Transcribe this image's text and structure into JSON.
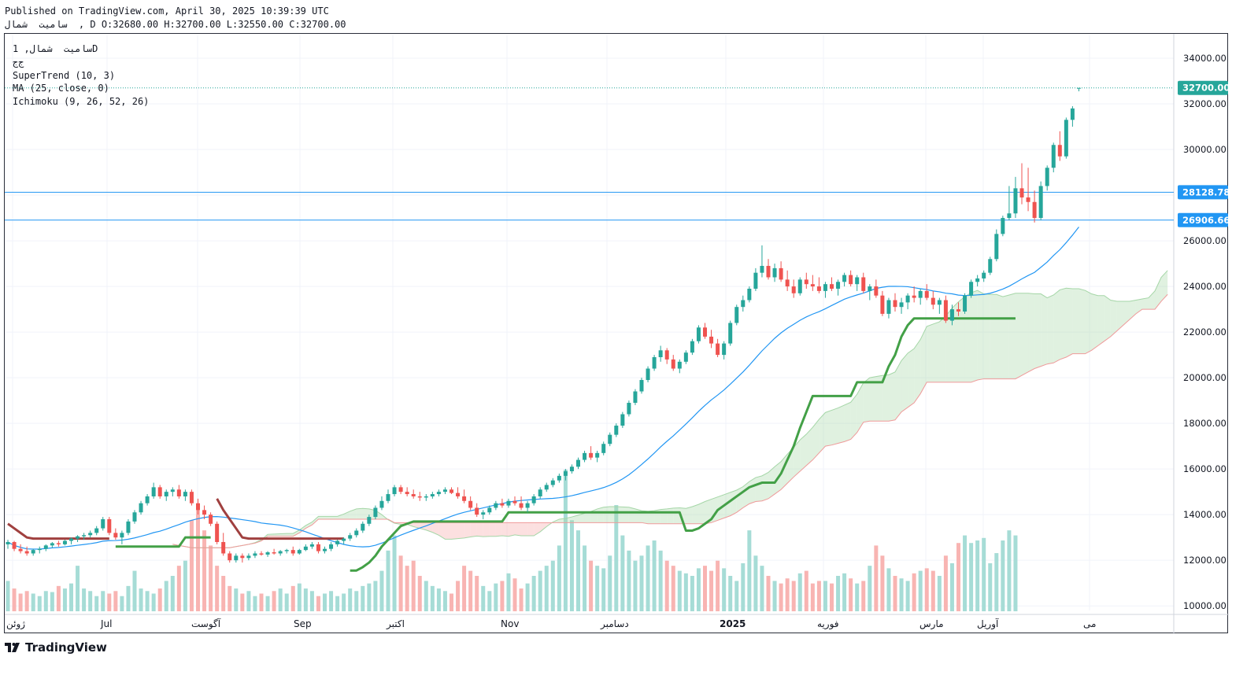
{
  "header": {
    "published": "Published on TradingView.com, April 30, 2025 10:39:39 UTC",
    "ohlc": "سامیت  شمال  , D O:32680.00 H:32700.00 L:32550.00 C:32700.00"
  },
  "legend": {
    "symbol": "سامیت  شمال, 1D",
    "exchange": "ج‌ج",
    "supertrend": "SuperTrend (10, 3)",
    "ma": "MA (25, close, 0)",
    "ichimoku": "Ichimoku (9, 26, 52, 26)"
  },
  "brand": "TradingView",
  "colors": {
    "up": "#26a69a",
    "down": "#ef5350",
    "supertrend_up": "#43a047",
    "supertrend_down": "#a0403f",
    "ma": "#2196f3",
    "cloud_green": "#a5d6a7",
    "cloud_red": "#f8bbbb",
    "hline": "#2196f3"
  },
  "chart_data": {
    "type": "candlestick",
    "ylim": [
      9800,
      35000
    ],
    "y_ticks": [
      "34000.00",
      "32000.00",
      "30000.00",
      "28000.00",
      "26000.00",
      "24000.00",
      "22000.00",
      "20000.00",
      "18000.00",
      "16000.00",
      "14000.00",
      "12000.00",
      "10000.00"
    ],
    "x_ticks": [
      "ژوئن",
      "Jul",
      "آگوست",
      "Sep",
      "اکتبر",
      "Nov",
      "دسامبر",
      "2025",
      "فوریه",
      "مارس",
      "آوریل",
      "می"
    ],
    "last_price": "32700.00",
    "horizontal_lines": [
      "28128.78",
      "26906.66"
    ],
    "candles": [
      [
        12700,
        12900,
        12500,
        12800
      ],
      [
        12800,
        12850,
        12400,
        12500
      ],
      [
        12500,
        12700,
        12300,
        12400
      ],
      [
        12400,
        12600,
        12200,
        12300
      ],
      [
        12300,
        12500,
        12200,
        12450
      ],
      [
        12450,
        12600,
        12300,
        12500
      ],
      [
        12500,
        12700,
        12400,
        12650
      ],
      [
        12650,
        12800,
        12550,
        12750
      ],
      [
        12750,
        12850,
        12600,
        12700
      ],
      [
        12700,
        12900,
        12650,
        12850
      ],
      [
        12850,
        13000,
        12700,
        12950
      ],
      [
        12950,
        13100,
        12800,
        13050
      ],
      [
        13050,
        13200,
        12900,
        13100
      ],
      [
        13100,
        13300,
        13000,
        13200
      ],
      [
        13200,
        13500,
        13100,
        13400
      ],
      [
        13400,
        13900,
        13300,
        13800
      ],
      [
        13800,
        13900,
        13100,
        13200
      ],
      [
        13200,
        13400,
        12900,
        13000
      ],
      [
        13000,
        13300,
        12700,
        13200
      ],
      [
        13200,
        13800,
        13100,
        13700
      ],
      [
        13700,
        14200,
        13600,
        14100
      ],
      [
        14100,
        14600,
        14000,
        14500
      ],
      [
        14500,
        14900,
        14400,
        14800
      ],
      [
        14800,
        15400,
        14700,
        15200
      ],
      [
        15200,
        15300,
        14700,
        14800
      ],
      [
        14800,
        15100,
        14600,
        15000
      ],
      [
        15000,
        15200,
        14800,
        15100
      ],
      [
        15100,
        15300,
        14700,
        14800
      ],
      [
        14800,
        15100,
        14600,
        15000
      ],
      [
        15000,
        15100,
        14400,
        14500
      ],
      [
        14500,
        14700,
        14000,
        14200
      ],
      [
        14200,
        14400,
        13800,
        14000
      ],
      [
        14000,
        14100,
        13500,
        13600
      ],
      [
        13600,
        13700,
        12700,
        12800
      ],
      [
        12800,
        13200,
        12200,
        12300
      ],
      [
        12300,
        12400,
        11900,
        12000
      ],
      [
        12000,
        12300,
        11900,
        12200
      ],
      [
        12200,
        12300,
        11900,
        12100
      ],
      [
        12100,
        12300,
        12000,
        12200
      ],
      [
        12200,
        12400,
        12100,
        12300
      ],
      [
        12300,
        12400,
        12200,
        12250
      ],
      [
        12250,
        12400,
        12150,
        12350
      ],
      [
        12350,
        12500,
        12250,
        12300
      ],
      [
        12300,
        12450,
        12200,
        12400
      ],
      [
        12400,
        12500,
        12300,
        12450
      ],
      [
        12450,
        12600,
        12200,
        12300
      ],
      [
        12300,
        12500,
        12250,
        12450
      ],
      [
        12450,
        12700,
        12400,
        12600
      ],
      [
        12600,
        12800,
        12500,
        12700
      ],
      [
        12700,
        12800,
        12300,
        12400
      ],
      [
        12400,
        12600,
        12300,
        12500
      ],
      [
        12500,
        12800,
        12400,
        12700
      ],
      [
        12700,
        12900,
        12600,
        12850
      ],
      [
        12850,
        13000,
        12700,
        12950
      ],
      [
        12950,
        13200,
        12850,
        13100
      ],
      [
        13100,
        13400,
        13000,
        13300
      ],
      [
        13300,
        13700,
        13200,
        13600
      ],
      [
        13600,
        14000,
        13500,
        13900
      ],
      [
        13900,
        14400,
        13800,
        14300
      ],
      [
        14300,
        14800,
        14200,
        14600
      ],
      [
        14600,
        15100,
        14500,
        14900
      ],
      [
        14900,
        15300,
        14800,
        15200
      ],
      [
        15200,
        15300,
        14900,
        15000
      ],
      [
        15000,
        15200,
        14800,
        14900
      ],
      [
        14900,
        15100,
        14700,
        14800
      ],
      [
        14800,
        15000,
        14600,
        14750
      ],
      [
        14750,
        14900,
        14600,
        14800
      ],
      [
        14800,
        15000,
        14700,
        14900
      ],
      [
        14900,
        15100,
        14800,
        15000
      ],
      [
        15000,
        15200,
        14900,
        15100
      ],
      [
        15100,
        15200,
        14900,
        14950
      ],
      [
        14950,
        15200,
        14700,
        14800
      ],
      [
        14800,
        15100,
        14500,
        14600
      ],
      [
        14600,
        14800,
        14200,
        14300
      ],
      [
        14300,
        14500,
        13900,
        14000
      ],
      [
        14000,
        14200,
        13800,
        14100
      ],
      [
        14100,
        14400,
        14000,
        14300
      ],
      [
        14300,
        14600,
        14200,
        14500
      ],
      [
        14500,
        14700,
        14300,
        14400
      ],
      [
        14400,
        14700,
        14300,
        14600
      ],
      [
        14600,
        14800,
        14400,
        14500
      ],
      [
        14500,
        14800,
        14200,
        14300
      ],
      [
        14300,
        14600,
        14100,
        14500
      ],
      [
        14500,
        14900,
        14400,
        14800
      ],
      [
        14800,
        15200,
        14700,
        15100
      ],
      [
        15100,
        15400,
        15000,
        15300
      ],
      [
        15300,
        15600,
        15200,
        15500
      ],
      [
        15500,
        15800,
        15400,
        15700
      ],
      [
        15700,
        16000,
        15500,
        15900
      ],
      [
        15900,
        16200,
        15800,
        16100
      ],
      [
        16100,
        16500,
        16000,
        16400
      ],
      [
        16400,
        16800,
        16300,
        16700
      ],
      [
        16700,
        17000,
        16400,
        16500
      ],
      [
        16500,
        16800,
        16300,
        16700
      ],
      [
        16700,
        17200,
        16600,
        17100
      ],
      [
        17100,
        17600,
        17000,
        17500
      ],
      [
        17500,
        18000,
        17400,
        17900
      ],
      [
        17900,
        18500,
        17800,
        18400
      ],
      [
        18400,
        19000,
        18300,
        18900
      ],
      [
        18900,
        19500,
        18800,
        19400
      ],
      [
        19400,
        20000,
        19300,
        19900
      ],
      [
        19900,
        20500,
        19800,
        20400
      ],
      [
        20400,
        21000,
        20300,
        20900
      ],
      [
        20900,
        21400,
        20700,
        21200
      ],
      [
        21200,
        21300,
        20600,
        20800
      ],
      [
        20800,
        21000,
        20300,
        20400
      ],
      [
        20400,
        20800,
        20200,
        20700
      ],
      [
        20700,
        21200,
        20600,
        21100
      ],
      [
        21100,
        21700,
        21000,
        21600
      ],
      [
        21600,
        22300,
        21500,
        22200
      ],
      [
        22200,
        22400,
        21700,
        21800
      ],
      [
        21800,
        22100,
        21300,
        21500
      ],
      [
        21500,
        21700,
        20900,
        21000
      ],
      [
        21000,
        21600,
        20800,
        21500
      ],
      [
        21500,
        22500,
        21400,
        22400
      ],
      [
        22400,
        23200,
        22300,
        23100
      ],
      [
        23100,
        23600,
        22900,
        23400
      ],
      [
        23400,
        24000,
        23300,
        23900
      ],
      [
        23900,
        24800,
        23800,
        24600
      ],
      [
        24600,
        25800,
        24400,
        24900
      ],
      [
        24900,
        25200,
        24300,
        24400
      ],
      [
        24400,
        25000,
        24200,
        24800
      ],
      [
        24800,
        25100,
        24200,
        24300
      ],
      [
        24300,
        24700,
        23800,
        24000
      ],
      [
        24000,
        24300,
        23500,
        23700
      ],
      [
        23700,
        24400,
        23600,
        24300
      ],
      [
        24300,
        24600,
        23900,
        24100
      ],
      [
        24100,
        24500,
        23800,
        24000
      ],
      [
        24000,
        24400,
        23700,
        23800
      ],
      [
        23800,
        24200,
        23500,
        24100
      ],
      [
        24100,
        24400,
        23800,
        23900
      ],
      [
        23900,
        24300,
        23600,
        24200
      ],
      [
        24200,
        24600,
        24000,
        24500
      ],
      [
        24500,
        24700,
        24000,
        24100
      ],
      [
        24100,
        24500,
        23800,
        24400
      ],
      [
        24400,
        24600,
        23700,
        23800
      ],
      [
        23800,
        24100,
        23400,
        24000
      ],
      [
        24000,
        24300,
        23500,
        23600
      ],
      [
        23600,
        23800,
        22700,
        22800
      ],
      [
        22800,
        23500,
        22600,
        23400
      ],
      [
        23400,
        23700,
        22900,
        23100
      ],
      [
        23100,
        23500,
        22800,
        23300
      ],
      [
        23300,
        23700,
        23000,
        23600
      ],
      [
        23600,
        24000,
        23300,
        23500
      ],
      [
        23500,
        23900,
        23200,
        23800
      ],
      [
        23800,
        24100,
        23400,
        23500
      ],
      [
        23500,
        23800,
        23000,
        23200
      ],
      [
        23200,
        23500,
        22800,
        23400
      ],
      [
        23400,
        23600,
        22400,
        22500
      ],
      [
        22500,
        23200,
        22300,
        23000
      ],
      [
        23000,
        23300,
        22700,
        22900
      ],
      [
        22900,
        23700,
        22800,
        23600
      ],
      [
        23600,
        24300,
        23500,
        24200
      ],
      [
        24200,
        24500,
        24000,
        24350
      ],
      [
        24350,
        24700,
        24200,
        24600
      ],
      [
        24600,
        25300,
        24500,
        25200
      ],
      [
        25200,
        26500,
        25100,
        26300
      ],
      [
        26300,
        27100,
        26200,
        27000
      ],
      [
        27000,
        28400,
        26900,
        27200
      ],
      [
        27200,
        28800,
        27000,
        28300
      ],
      [
        28300,
        29400,
        27600,
        27900
      ],
      [
        27900,
        29200,
        27300,
        27700
      ],
      [
        27700,
        28200,
        26800,
        27000
      ],
      [
        27000,
        28600,
        26900,
        28400
      ],
      [
        28400,
        29300,
        28200,
        29200
      ],
      [
        29200,
        30300,
        29000,
        30200
      ],
      [
        30200,
        30800,
        29500,
        29700
      ],
      [
        29700,
        31400,
        29600,
        31300
      ],
      [
        31300,
        31900,
        31000,
        31800
      ],
      [
        32680,
        32700,
        32550,
        32700
      ]
    ],
    "volume": [
      60,
      45,
      35,
      40,
      35,
      30,
      40,
      38,
      50,
      45,
      55,
      90,
      45,
      40,
      30,
      40,
      35,
      40,
      30,
      50,
      80,
      45,
      40,
      35,
      45,
      60,
      70,
      90,
      100,
      180,
      200,
      160,
      130,
      90,
      70,
      50,
      45,
      35,
      40,
      30,
      35,
      30,
      40,
      45,
      35,
      50,
      55,
      45,
      40,
      30,
      35,
      40,
      30,
      35,
      45,
      40,
      50,
      55,
      60,
      80,
      120,
      150,
      110,
      90,
      100,
      70,
      60,
      50,
      45,
      40,
      35,
      60,
      90,
      80,
      70,
      50,
      40,
      55,
      60,
      75,
      65,
      45,
      55,
      70,
      80,
      90,
      100,
      130,
      280,
      180,
      160,
      130,
      100,
      90,
      85,
      110,
      210,
      150,
      120,
      100,
      110,
      130,
      140,
      120,
      100,
      90,
      80,
      75,
      70,
      85,
      90,
      80,
      100,
      85,
      70,
      60,
      95,
      160,
      110,
      90,
      70,
      60,
      55,
      65,
      60,
      75,
      80,
      55,
      60,
      60,
      55,
      70,
      75,
      65,
      55,
      60,
      90,
      130,
      110,
      85,
      70,
      65,
      60,
      75,
      80,
      85,
      80,
      70,
      110,
      95,
      135,
      150,
      135,
      140,
      145,
      95,
      115,
      140,
      160,
      150
    ],
    "supertrend": [
      13600,
      13400,
      13200,
      13000,
      12950,
      12950,
      12950,
      12950,
      12950,
      12950,
      12950,
      12950,
      12950,
      12950,
      12950,
      12950,
      12950,
      12600,
      12600,
      12600,
      12600,
      12600,
      12600,
      12600,
      12600,
      12600,
      12600,
      12600,
      13000,
      13000,
      13000,
      13000,
      13000,
      14700,
      14200,
      13800,
      13400,
      13000,
      12950,
      12950,
      12950,
      12950,
      12950,
      12950,
      12950,
      12950,
      12950,
      12950,
      12950,
      12950,
      12950,
      12950,
      12950,
      12950,
      11550,
      11550,
      11700,
      11900,
      12200,
      12600,
      12900,
      13200,
      13500,
      13600,
      13700,
      13700,
      13700,
      13700,
      13700,
      13700,
      13700,
      13700,
      13700,
      13700,
      13700,
      13700,
      13700,
      13700,
      13700,
      14100,
      14100,
      14100,
      14100,
      14100,
      14100,
      14100,
      14100,
      14100,
      14100,
      14100,
      14100,
      14100,
      14100,
      14100,
      14100,
      14100,
      14100,
      14100,
      14100,
      14100,
      14100,
      14100,
      14100,
      14100,
      14100,
      14100,
      14100,
      13300,
      13300,
      13400,
      13600,
      13800,
      14200,
      14400,
      14600,
      14800,
      15000,
      15200,
      15300,
      15400,
      15400,
      15400,
      15800,
      16400,
      17000,
      17800,
      18500,
      19200,
      19200,
      19200,
      19200,
      19200,
      19200,
      19200,
      19800,
      19800,
      19800,
      19800,
      19800,
      20500,
      21000,
      21800,
      22300,
      22600,
      22600,
      22600,
      22600,
      22600,
      22600,
      22600,
      22600,
      22600,
      22600,
      22600,
      22600,
      22600,
      22600,
      22600,
      22600,
      22600
    ],
    "supertrend_dir": [
      -1,
      -1,
      -1,
      -1,
      -1,
      -1,
      -1,
      -1,
      -1,
      -1,
      -1,
      -1,
      -1,
      -1,
      -1,
      -1,
      -1,
      1,
      1,
      1,
      1,
      1,
      1,
      1,
      1,
      1,
      1,
      1,
      1,
      1,
      1,
      1,
      1,
      -1,
      -1,
      -1,
      -1,
      -1,
      -1,
      -1,
      -1,
      -1,
      -1,
      -1,
      -1,
      -1,
      -1,
      -1,
      -1,
      -1,
      -1,
      -1,
      -1,
      -1,
      1,
      1,
      1,
      1,
      1,
      1,
      1,
      1,
      1,
      1,
      1,
      1,
      1,
      1,
      1,
      1,
      1,
      1,
      1,
      1,
      1,
      1,
      1,
      1,
      1,
      1,
      1,
      1,
      1,
      1,
      1,
      1,
      1,
      1,
      1,
      1,
      1,
      1,
      1,
      1,
      1,
      1,
      1,
      1,
      1,
      1,
      1,
      1,
      1,
      1,
      1,
      1,
      1,
      1,
      1,
      1,
      1,
      1,
      1,
      1,
      1,
      1,
      1,
      1,
      1,
      1,
      1,
      1,
      1,
      1,
      1,
      1,
      1,
      1,
      1,
      1,
      1,
      1,
      1,
      1,
      1,
      1,
      1,
      1,
      1,
      1,
      1,
      1,
      1,
      1,
      1,
      1,
      1,
      1,
      1,
      1,
      1,
      1,
      1,
      1,
      1,
      1,
      1,
      1,
      1,
      1
    ]
  }
}
